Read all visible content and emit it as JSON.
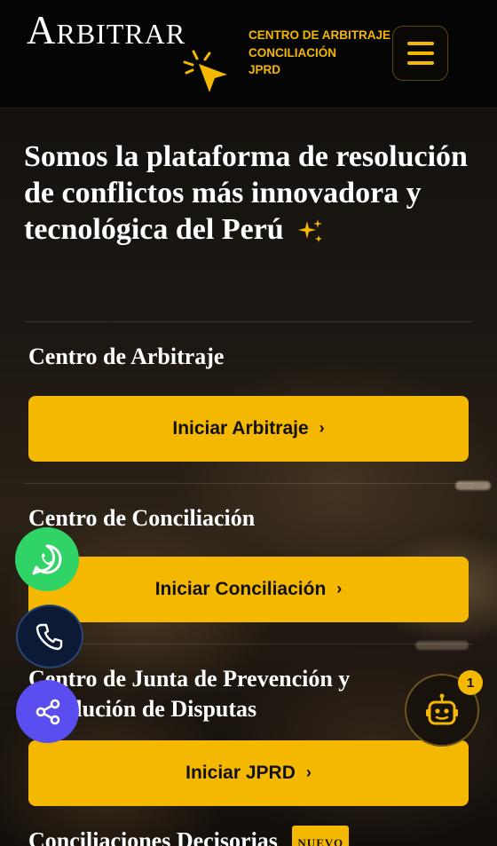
{
  "header": {
    "logo_text": "Arbitrar",
    "brand_lines": [
      "CENTRO DE ARBITRAJE",
      "CONCILIACIÓN",
      "JPRD"
    ],
    "menu_icon": "hamburger-menu-icon"
  },
  "hero": {
    "title": "Somos la plataforma de resolución de conflictos más innovadora y tecnológica del Perú",
    "icon": "sparkles-icon"
  },
  "sections": [
    {
      "title": "Centro de Arbitraje",
      "button_label": "Iniciar Arbitraje"
    },
    {
      "title": "Centro de Conciliación",
      "button_label": "Iniciar Conciliación"
    },
    {
      "title": "Centro de Junta de Prevención y Resolución de Disputas",
      "button_label": "Iniciar JPRD"
    },
    {
      "title": "Conciliaciones Decisorias",
      "badge": "NUEVO"
    }
  ],
  "floating": {
    "whatsapp_icon": "whatsapp-icon",
    "phone_icon": "phone-icon",
    "share_icon": "share-icon",
    "chatbot_icon": "robot-icon",
    "chatbot_badge": "1"
  },
  "colors": {
    "accent": "#f5b800",
    "header_bg": "#050505",
    "whatsapp": "#2fd366",
    "phone": "#0d1a36",
    "share": "#5b4ef0"
  }
}
